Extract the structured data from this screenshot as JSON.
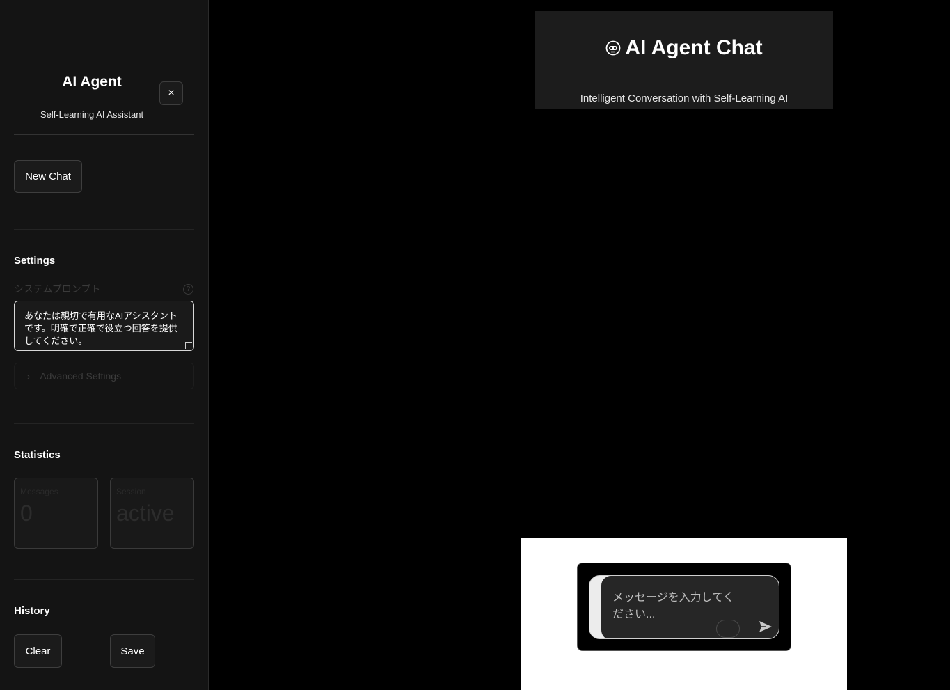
{
  "sidebar": {
    "title": "AI Agent",
    "subtitle": "Self-Learning AI Assistant",
    "close_icon": "×",
    "new_chat_label": "New Chat",
    "settings": {
      "heading": "Settings",
      "prompt_label": "システムプロンプト",
      "help_icon": "?",
      "system_prompt": "あなたは親切で有用なAIアシスタントです。明確で正確で役立つ回答を提供してください。",
      "advanced_label": "Advanced Settings",
      "advanced_chevron": "›"
    },
    "statistics": {
      "heading": "Statistics",
      "messages_label": "Messages",
      "messages_value": "0",
      "session_label": "Session",
      "session_value": "active"
    },
    "history": {
      "heading": "History",
      "clear_label": "Clear",
      "save_label": "Save"
    }
  },
  "main": {
    "title": "AI Agent Chat",
    "title_icon": "robot-icon",
    "subtitle": "Intelligent Conversation with Self-Learning AI",
    "chat_input": {
      "placeholder": "メッセージを入力してください...",
      "send_icon": "send-icon",
      "voice_toggle": "toggle"
    }
  },
  "colors": {
    "background": "#000000",
    "sidebar": "#141414",
    "header": "#1c1c1c",
    "input_panel": "#ffffff"
  }
}
